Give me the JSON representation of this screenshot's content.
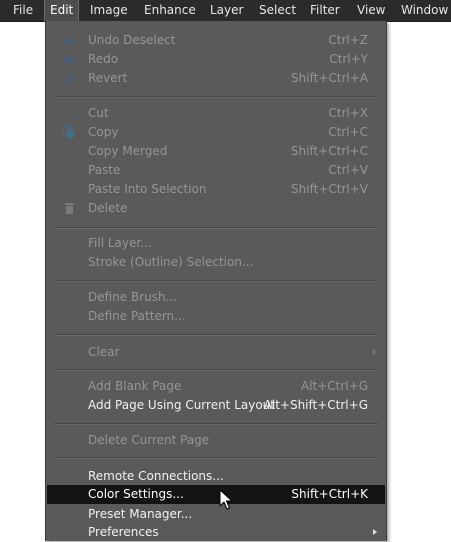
{
  "menubar": {
    "items": [
      {
        "label": "File"
      },
      {
        "label": "Edit"
      },
      {
        "label": "Image"
      },
      {
        "label": "Enhance"
      },
      {
        "label": "Layer"
      },
      {
        "label": "Select"
      },
      {
        "label": "Filter"
      },
      {
        "label": "View"
      },
      {
        "label": "Window"
      }
    ],
    "active": "Edit"
  },
  "edit_menu": {
    "items": [
      {
        "label": "Undo Deselect",
        "shortcut": "Ctrl+Z",
        "enabled": false,
        "icon": "undo-icon"
      },
      {
        "label": "Redo",
        "shortcut": "Ctrl+Y",
        "enabled": false,
        "icon": "redo-icon"
      },
      {
        "label": "Revert",
        "shortcut": "Shift+Ctrl+A",
        "enabled": false,
        "icon": "revert-icon"
      },
      {
        "label": "Cut",
        "shortcut": "Ctrl+X",
        "enabled": false
      },
      {
        "label": "Copy",
        "shortcut": "Ctrl+C",
        "enabled": false,
        "icon": "copy-icon"
      },
      {
        "label": "Copy Merged",
        "shortcut": "Shift+Ctrl+C",
        "enabled": false
      },
      {
        "label": "Paste",
        "shortcut": "Ctrl+V",
        "enabled": false
      },
      {
        "label": "Paste Into Selection",
        "shortcut": "Shift+Ctrl+V",
        "enabled": false
      },
      {
        "label": "Delete",
        "shortcut": "",
        "enabled": false,
        "icon": "trash-icon"
      },
      {
        "label": "Fill Layer...",
        "shortcut": "",
        "enabled": false
      },
      {
        "label": "Stroke (Outline) Selection...",
        "shortcut": "",
        "enabled": false
      },
      {
        "label": "Define Brush...",
        "shortcut": "",
        "enabled": false
      },
      {
        "label": "Define Pattern...",
        "shortcut": "",
        "enabled": false
      },
      {
        "label": "Clear",
        "shortcut": "",
        "enabled": false,
        "submenu": true
      },
      {
        "label": "Add Blank Page",
        "shortcut": "Alt+Ctrl+G",
        "enabled": false
      },
      {
        "label": "Add Page Using Current Layout",
        "shortcut": "Alt+Shift+Ctrl+G",
        "enabled": true
      },
      {
        "label": "Delete Current Page",
        "shortcut": "",
        "enabled": false
      },
      {
        "label": "Remote Connections...",
        "shortcut": "",
        "enabled": true
      },
      {
        "label": "Color Settings...",
        "shortcut": "Shift+Ctrl+K",
        "enabled": true,
        "highlighted": true
      },
      {
        "label": "Preset Manager...",
        "shortcut": "",
        "enabled": true
      },
      {
        "label": "Preferences",
        "shortcut": "",
        "enabled": true,
        "submenu": true
      }
    ]
  },
  "colors": {
    "menubar_bg": "#2b2b2b",
    "menu_bg": "#5a5a5a",
    "highlight_bg": "#141414",
    "disabled_text": "#959595",
    "enabled_text": "#f0f0f0"
  }
}
